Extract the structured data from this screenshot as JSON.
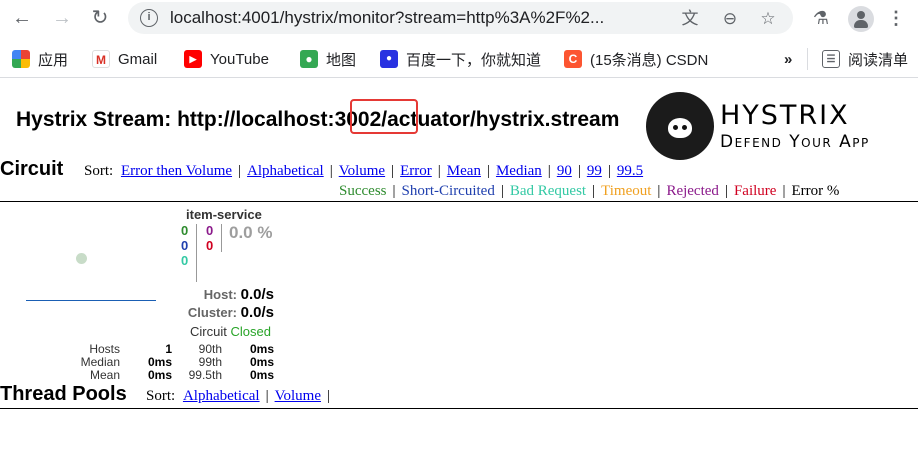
{
  "browser": {
    "url": "localhost:4001/hystrix/monitor?stream=http%3A%2F%2...",
    "bookmarks": [
      {
        "label": "应用",
        "icon": "apps-grid-icon"
      },
      {
        "label": "Gmail",
        "icon": "gmail-icon"
      },
      {
        "label": "YouTube",
        "icon": "youtube-icon"
      },
      {
        "label": "地图",
        "icon": "maps-icon"
      },
      {
        "label": "百度一下，你就知道",
        "icon": "baidu-icon"
      },
      {
        "label": "(15条消息) CSDN",
        "icon": "csdn-icon"
      }
    ],
    "more_bookmarks": "»",
    "reading_list": "阅读清单"
  },
  "header": {
    "title_prefix": "Hystrix Stream: http://localhost:",
    "title_port": "3002/",
    "title_suffix": "actuator/hystrix.stream",
    "logo_brand": "HYSTRIX",
    "logo_tagline": "Defend Your App"
  },
  "circuit": {
    "heading": "Circuit",
    "sort_label": "Sort:",
    "sort_options": [
      "Error then Volume",
      "Alphabetical",
      "Volume",
      "Error",
      "Mean",
      "Median",
      "90",
      "99",
      "99.5"
    ],
    "legend": [
      {
        "label": "Success",
        "color": "#2e8b2e"
      },
      {
        "label": "Short-Circuited",
        "color": "#1f3fae"
      },
      {
        "label": "Bad Request",
        "color": "#33c9a4"
      },
      {
        "label": "Timeout",
        "color": "#f0a020"
      },
      {
        "label": "Rejected",
        "color": "#8b1a8b"
      },
      {
        "label": "Failure",
        "color": "#d00020"
      },
      {
        "label": "Error %",
        "color": "#000000"
      }
    ],
    "card": {
      "name": "item-service",
      "success": "0",
      "short_circuited": "0",
      "bad_request": "0",
      "timeout": "0",
      "rejected": "0",
      "failure": "0",
      "error_pct": "0.0 %",
      "host_label": "Host:",
      "host_rate": "0.0/s",
      "cluster_label": "Cluster:",
      "cluster_rate": "0.0/s",
      "status_label": "Circuit",
      "status_value": "Closed",
      "latency": [
        {
          "k1": "Hosts",
          "v1": "1",
          "k2": "90th",
          "v2": "0ms"
        },
        {
          "k1": "Median",
          "v1": "0ms",
          "k2": "99th",
          "v2": "0ms"
        },
        {
          "k1": "Mean",
          "v1": "0ms",
          "k2": "99.5th",
          "v2": "0ms"
        }
      ]
    }
  },
  "thread_pools": {
    "heading": "Thread Pools",
    "sort_label": "Sort:",
    "sort_options": [
      "Alphabetical",
      "Volume"
    ]
  }
}
